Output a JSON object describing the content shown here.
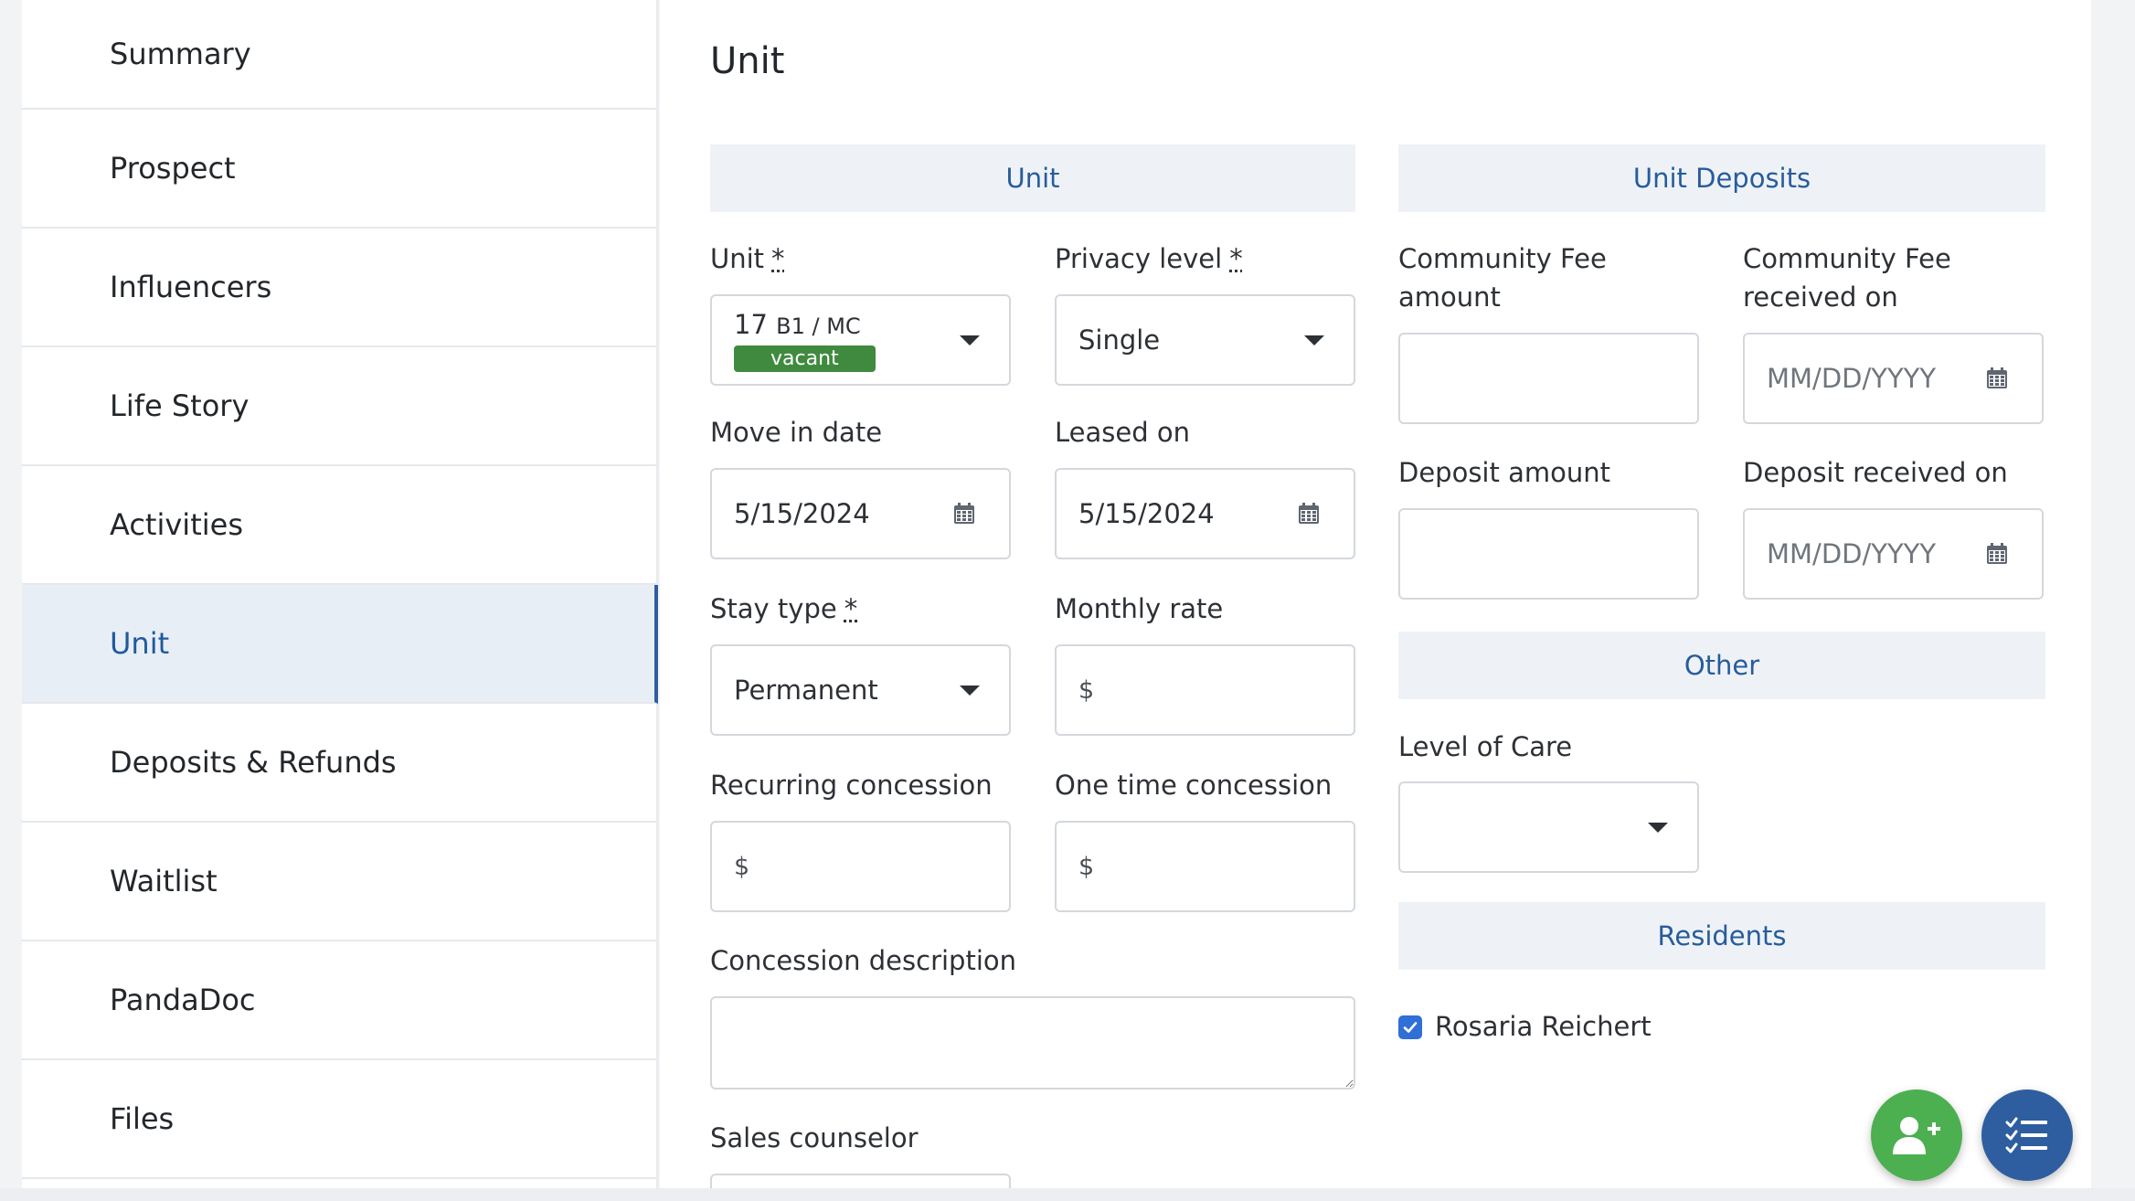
{
  "sidebar": {
    "items": [
      {
        "label": "Summary"
      },
      {
        "label": "Prospect"
      },
      {
        "label": "Influencers"
      },
      {
        "label": "Life Story"
      },
      {
        "label": "Activities"
      },
      {
        "label": "Unit",
        "active": true
      },
      {
        "label": "Deposits & Refunds"
      },
      {
        "label": "Waitlist"
      },
      {
        "label": "PandaDoc"
      },
      {
        "label": "Files"
      }
    ]
  },
  "page": {
    "title": "Unit"
  },
  "sections": {
    "unit": "Unit",
    "unit_deposits": "Unit Deposits",
    "other": "Other",
    "residents": "Residents"
  },
  "fields": {
    "unit": {
      "label": "Unit",
      "required_mark": "*",
      "number": "17",
      "detail": "B1 / MC",
      "status": "vacant"
    },
    "privacy_level": {
      "label": "Privacy level",
      "required_mark": "*",
      "value": "Single"
    },
    "move_in_date": {
      "label": "Move in date",
      "value": "5/15/2024"
    },
    "leased_on": {
      "label": "Leased on",
      "value": "5/15/2024"
    },
    "stay_type": {
      "label": "Stay type",
      "required_mark": "*",
      "value": "Permanent"
    },
    "monthly_rate": {
      "label": "Monthly rate",
      "prefix": "$",
      "value": ""
    },
    "recurring_concession": {
      "label": "Recurring concession",
      "prefix": "$",
      "value": ""
    },
    "one_time_concession": {
      "label": "One time concession",
      "prefix": "$",
      "value": ""
    },
    "concession_description": {
      "label": "Concession description",
      "value": ""
    },
    "sales_counselor": {
      "label": "Sales counselor"
    },
    "community_fee_amount": {
      "label_line1": "Community Fee",
      "label_line2": "amount",
      "value": ""
    },
    "community_fee_received_on": {
      "label_line1": "Community Fee",
      "label_line2": "received on",
      "placeholder": "MM/DD/YYYY"
    },
    "deposit_amount": {
      "label": "Deposit amount",
      "value": ""
    },
    "deposit_received_on": {
      "label": "Deposit received on",
      "placeholder": "MM/DD/YYYY"
    },
    "level_of_care": {
      "label": "Level of Care",
      "value": ""
    }
  },
  "residents": [
    {
      "name": "Rosaria Reichert",
      "checked": true
    }
  ],
  "fabs": {
    "add_person": {
      "icon": "add-person-icon",
      "color": "#4caf50"
    },
    "checklist": {
      "icon": "checklist-icon",
      "color": "#2e5ea0"
    }
  },
  "colors": {
    "accent": "#275c9b",
    "active_nav_bg": "#e8eef6",
    "badge_green": "#3f8a3f",
    "section_bg": "#eef2f7"
  }
}
